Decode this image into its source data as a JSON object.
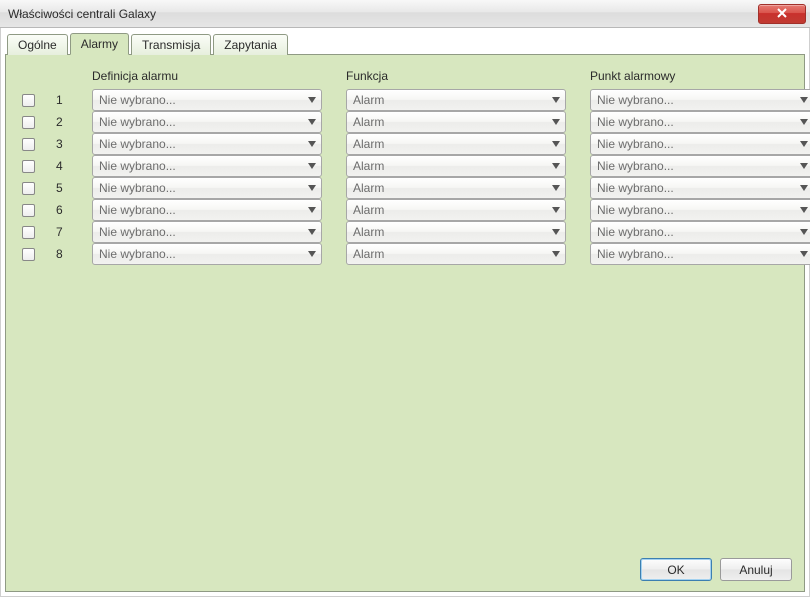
{
  "window": {
    "title": "Właściwości centrali Galaxy"
  },
  "tabs": [
    {
      "label": "Ogólne",
      "active": false
    },
    {
      "label": "Alarmy",
      "active": true
    },
    {
      "label": "Transmisja",
      "active": false
    },
    {
      "label": "Zapytania",
      "active": false
    }
  ],
  "columns": {
    "definition": "Definicja alarmu",
    "function": "Funkcja",
    "point": "Punkt alarmowy"
  },
  "rows": [
    {
      "num": "1",
      "checked": false,
      "definition": "Nie wybrano...",
      "function": "Alarm",
      "point": "Nie wybrano..."
    },
    {
      "num": "2",
      "checked": false,
      "definition": "Nie wybrano...",
      "function": "Alarm",
      "point": "Nie wybrano..."
    },
    {
      "num": "3",
      "checked": false,
      "definition": "Nie wybrano...",
      "function": "Alarm",
      "point": "Nie wybrano..."
    },
    {
      "num": "4",
      "checked": false,
      "definition": "Nie wybrano...",
      "function": "Alarm",
      "point": "Nie wybrano..."
    },
    {
      "num": "5",
      "checked": false,
      "definition": "Nie wybrano...",
      "function": "Alarm",
      "point": "Nie wybrano..."
    },
    {
      "num": "6",
      "checked": false,
      "definition": "Nie wybrano...",
      "function": "Alarm",
      "point": "Nie wybrano..."
    },
    {
      "num": "7",
      "checked": false,
      "definition": "Nie wybrano...",
      "function": "Alarm",
      "point": "Nie wybrano..."
    },
    {
      "num": "8",
      "checked": false,
      "definition": "Nie wybrano...",
      "function": "Alarm",
      "point": "Nie wybrano..."
    }
  ],
  "buttons": {
    "ok": "OK",
    "cancel": "Anuluj"
  }
}
